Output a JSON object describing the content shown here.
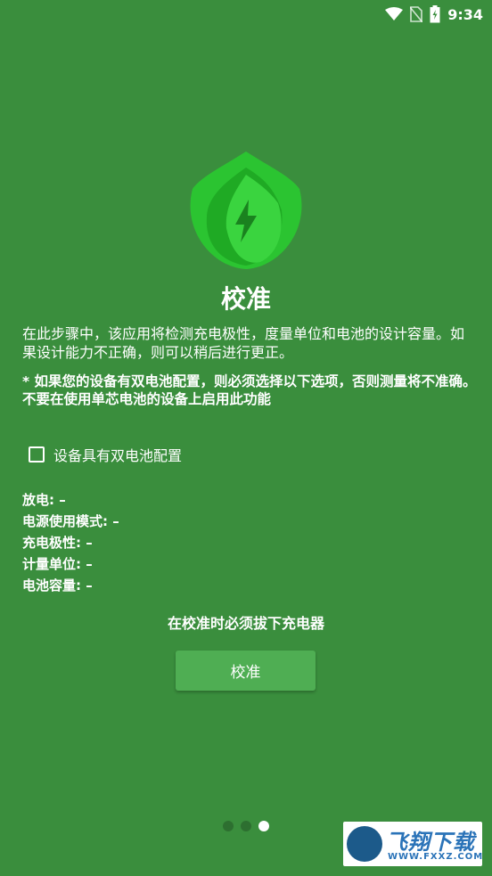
{
  "status_bar": {
    "time": "9:34"
  },
  "title": "校准",
  "description": "在此步骤中，该应用将检测充电极性，度量单位和电池的设计容量。如果设计能力不正确，则可以稍后进行更正。",
  "warning": {
    "line1": "* 如果您的设备有双电池配置，则必须选择以下选项，否则测量将不准确。",
    "line2": "不要在使用单芯电池的设备上启用此功能"
  },
  "checkbox": {
    "label": "设备具有双电池配置",
    "checked": false
  },
  "info": {
    "discharge": "放电: –",
    "power_mode": "电源使用模式: –",
    "polarity": "充电极性: –",
    "unit": "计量单位: –",
    "capacity": "电池容量: –"
  },
  "unplug_notice": "在校准时必须拔下充电器",
  "calibrate_button": "校准",
  "pager": {
    "pages": 3,
    "active": 3
  },
  "watermark": {
    "text": "飞翔下载",
    "sub": "WWW.FXXZ.COM"
  }
}
